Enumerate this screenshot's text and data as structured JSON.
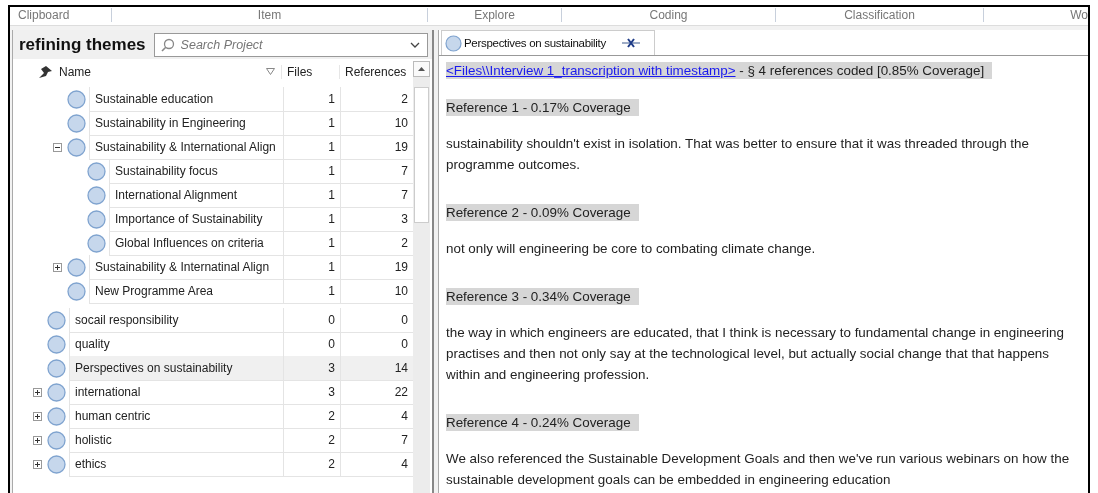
{
  "ribbon_groups": [
    "Clipboard",
    "Item",
    "Explore",
    "Coding",
    "Classification",
    "Wo"
  ],
  "navigation": {
    "title": "refining themes",
    "search": {
      "placeholder": "Search Project"
    }
  },
  "tree": {
    "columns": [
      "Name",
      "Files",
      "References"
    ],
    "nested_rows": [
      {
        "name": "Sustainable education",
        "files": "1",
        "references": "2",
        "selected": false
      },
      {
        "name": "Sustainability in Engineering",
        "files": "1",
        "references": "10",
        "selected": false
      },
      {
        "name": "Sustainability & International Align",
        "files": "1",
        "references": "19",
        "expanded": true,
        "selected": false,
        "children": [
          {
            "name": "Sustainability focus",
            "files": "1",
            "references": "7",
            "selected": false
          },
          {
            "name": "International Alignment",
            "files": "1",
            "references": "7",
            "selected": false
          },
          {
            "name": "Importance of Sustainability",
            "files": "1",
            "references": "3",
            "selected": false
          },
          {
            "name": "Global Influences on criteria",
            "files": "1",
            "references": "2",
            "selected": false
          }
        ]
      },
      {
        "name": "Sustainability & Internatinal Align",
        "files": "1",
        "references": "19",
        "expanded": false,
        "selected": false
      },
      {
        "name": "New Programme Area",
        "files": "1",
        "references": "10",
        "selected": false
      }
    ],
    "rows": [
      {
        "name": "socail responsibility",
        "files": "0",
        "references": "0",
        "selected": false
      },
      {
        "name": "quality",
        "files": "0",
        "references": "0",
        "selected": false
      },
      {
        "name": "Perspectives on sustainability",
        "files": "3",
        "references": "14",
        "selected": true
      },
      {
        "name": "international",
        "files": "3",
        "references": "22",
        "expanded": false,
        "selected": false
      },
      {
        "name": "human centric",
        "files": "2",
        "references": "4",
        "expanded": false,
        "selected": false
      },
      {
        "name": "holistic",
        "files": "2",
        "references": "7",
        "expanded": false,
        "selected": false
      },
      {
        "name": "ethics",
        "files": "2",
        "references": "4",
        "expanded": false,
        "selected": false
      }
    ]
  },
  "detail": {
    "tab": {
      "label": "Perspectives on sustainability"
    },
    "source_link": "<Files\\\\Interview 1_transcription with timestamp>",
    "source_summary": " - § 4 references coded  [0.85% Coverage]",
    "references": [
      {
        "heading": "Reference 1 - 0.17% Coverage",
        "text": "sustainability shouldn't exist in isolation. That was better to ensure that it was threaded through the programme outcomes."
      },
      {
        "heading": "Reference 2 - 0.09% Coverage",
        "text": "not only will engineering be core to combating climate change."
      },
      {
        "heading": "Reference 3 - 0.34% Coverage",
        "text": "the way in which engineers are educated, that I think is necessary to fundamental change in engineering practises and then not only say at the technological level, but actually social change that that happens within and engineering profession."
      },
      {
        "heading": "Reference 4 - 0.24% Coverage",
        "text": "We also referenced the Sustainable Development Goals and then we've run various webinars on how the sustainable development goals can be embedded in engineering education"
      }
    ]
  }
}
